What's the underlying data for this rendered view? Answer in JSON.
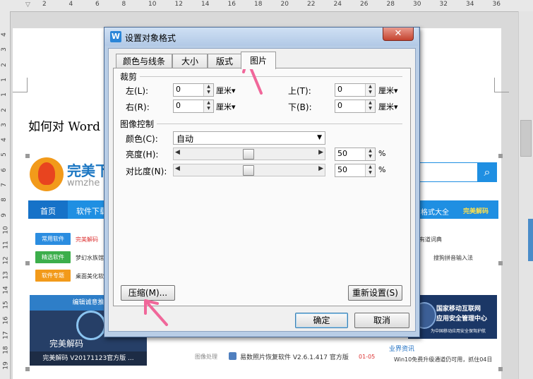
{
  "ruler": {
    "h_numbers": [
      "2",
      "4",
      "6",
      "8",
      "10",
      "12",
      "14",
      "16",
      "18",
      "20",
      "22",
      "24",
      "26",
      "28",
      "30",
      "32",
      "34",
      "36"
    ],
    "v_numbers": [
      "4",
      "3",
      "2",
      "1",
      "1",
      "2",
      "3",
      "4",
      "5",
      "6",
      "7",
      "8",
      "9",
      "10",
      "11",
      "12",
      "13",
      "14",
      "15",
      "16",
      "17",
      "18",
      "19"
    ]
  },
  "document": {
    "heading": "如何对 Word"
  },
  "website": {
    "logo_text": "完美下",
    "logo_sub": "wmzhe",
    "nav": {
      "home": "首页",
      "software": "软件下载",
      "right1": "格式大全",
      "right2": "完美解码"
    },
    "tags": [
      {
        "label": "常用软件",
        "color": "#2b8de0"
      },
      {
        "label": "精选软件",
        "color": "#3cae4b"
      },
      {
        "label": "软件专题",
        "color": "#f29a1a"
      }
    ],
    "left_lines": [
      "完美解码",
      "梦幻水族馆",
      "桌面美化软"
    ],
    "right_lines": [
      "有道词典",
      "搜狗拼音输入法"
    ],
    "banner_left": {
      "top": "编辑诚意推",
      "middle": "完美解码",
      "caption": "完美解码 V20171123官方版 ..."
    },
    "banner_right": {
      "line1": "国家移动互联网",
      "line2": "应用安全管理中心",
      "line3": "为中国移动应用安全保驾护航"
    },
    "bottom": {
      "category": "图像处理",
      "item": "易数照片恢复软件 V2.6.1.417 官方版",
      "date": "01-05",
      "news_title": "业界资讯",
      "news_item": "Win10免费升级通道仍可用，抓住04日"
    }
  },
  "dialog": {
    "title": "设置对象格式",
    "close_label": "✕",
    "tabs": [
      "颜色与线条",
      "大小",
      "版式",
      "图片"
    ],
    "active_tab": "图片",
    "crop": {
      "section_label": "裁剪",
      "left_label": "左(L):",
      "left_value": "0",
      "right_label": "右(R):",
      "right_value": "0",
      "top_label": "上(T):",
      "top_value": "0",
      "bottom_label": "下(B):",
      "bottom_value": "0",
      "unit": "厘米▾"
    },
    "image_control": {
      "section_label": "图像控制",
      "color_label": "颜色(C):",
      "color_value": "自动",
      "brightness_label": "亮度(H):",
      "brightness_value": "50",
      "brightness_level": 0.5,
      "contrast_label": "对比度(N):",
      "contrast_value": "50",
      "contrast_level": 0.5,
      "percent": "%"
    },
    "compress_label": "压缩(M)...",
    "reset_label": "重新设置(S)",
    "ok_label": "确定",
    "cancel_label": "取消"
  },
  "colors": {
    "annotation_arrow": "#f0679a",
    "site_blue": "#1f8fe2"
  }
}
